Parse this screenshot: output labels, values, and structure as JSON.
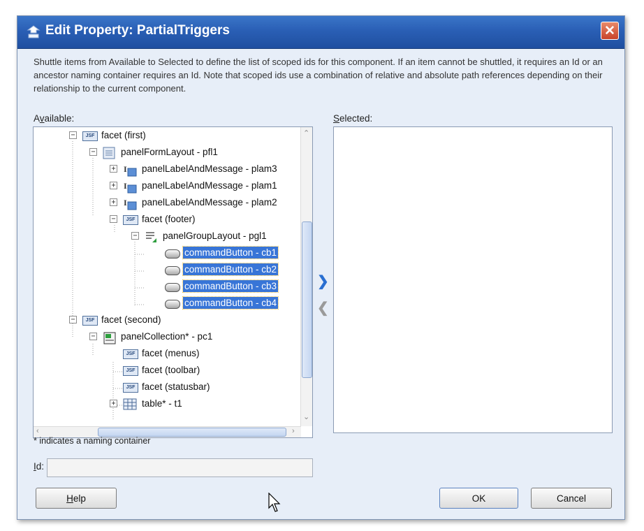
{
  "window": {
    "title": "Edit Property: PartialTriggers",
    "close_label": "✕"
  },
  "description": "Shuttle items from Available to Selected to define the list of scoped ids for this component. If an item cannot be shuttled, it requires an Id or an ancestor naming container requires an Id. Note that scoped ids use a combination of relative and absolute path references depending on their relationship to the current component.",
  "available": {
    "label_pre": "A",
    "label_ul": "v",
    "label_post": "ailable:",
    "tree": [
      {
        "label": "facet (first)",
        "icon": "jsf-facet-icon",
        "expander": "−"
      },
      {
        "label": "panelFormLayout - pfl1",
        "icon": "form-layout-icon",
        "expander": "−"
      },
      {
        "label": "panelLabelAndMessage - plam3",
        "icon": "label-message-icon",
        "expander": "+"
      },
      {
        "label": "panelLabelAndMessage - plam1",
        "icon": "label-message-icon",
        "expander": "+"
      },
      {
        "label": "panelLabelAndMessage - plam2",
        "icon": "label-message-icon",
        "expander": "+"
      },
      {
        "label": "facet (footer)",
        "icon": "jsf-facet-icon",
        "expander": "−"
      },
      {
        "label": "panelGroupLayout - pgl1",
        "icon": "group-layout-icon",
        "expander": "−"
      },
      {
        "label": "commandButton - cb1",
        "icon": "command-button-icon",
        "selected": true
      },
      {
        "label": "commandButton - cb2",
        "icon": "command-button-icon",
        "selected": true
      },
      {
        "label": "commandButton - cb3",
        "icon": "command-button-icon",
        "selected": true
      },
      {
        "label": "commandButton - cb4",
        "icon": "command-button-icon",
        "selected": true
      },
      {
        "label": "facet (second)",
        "icon": "jsf-facet-icon",
        "expander": "−"
      },
      {
        "label": "panelCollection* - pc1",
        "icon": "panel-collection-icon",
        "expander": "−"
      },
      {
        "label": "facet (menus)",
        "icon": "jsf-facet-icon"
      },
      {
        "label": "facet (toolbar)",
        "icon": "jsf-facet-icon"
      },
      {
        "label": "facet (statusbar)",
        "icon": "jsf-facet-icon"
      },
      {
        "label": "table* - t1",
        "icon": "table-icon",
        "expander": "+"
      }
    ]
  },
  "selected": {
    "label_ul": "S",
    "label_post": "elected:"
  },
  "shuttle": {
    "add": "❯",
    "remove": "❮"
  },
  "footnote": "* indicates a naming container",
  "id_field": {
    "label_ul": "I",
    "label_post": "d:",
    "value": ""
  },
  "buttons": {
    "help_ul": "H",
    "help_post": "elp",
    "ok": "OK",
    "cancel": "Cancel"
  },
  "colors": {
    "title_bar": "#2a5fb5",
    "selection": "#3875d7",
    "close": "#d0503a"
  },
  "jsf_icon_text": "JSF"
}
